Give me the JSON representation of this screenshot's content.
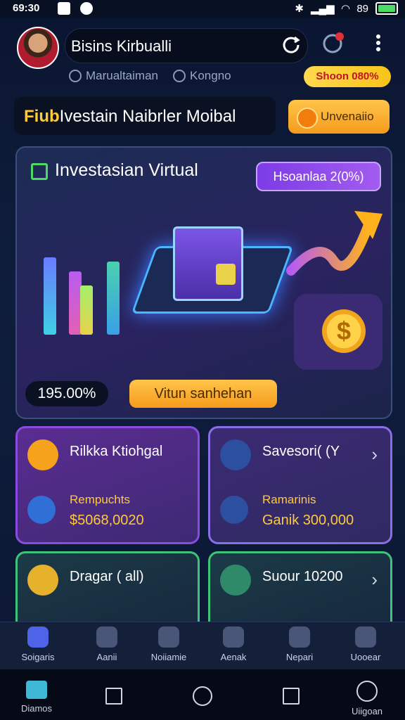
{
  "status": {
    "time": "69:30",
    "battery": "89"
  },
  "header": {
    "search_text": "Bisins Kirbualli"
  },
  "locations": [
    "Marualtaiman",
    "Kongno"
  ],
  "promo_pill": "Shoon 080%",
  "title_bar": {
    "prefix": "Fiub",
    "rest": "Ivestain Naibrler  Moibal"
  },
  "invest_button": "Unvenaiio",
  "hero": {
    "title": "Investasian Virtual",
    "percent_badge": "Hsoanlaa 2(0%)",
    "rate": "195.00%",
    "cta": "Vitun sanhehan"
  },
  "cards": [
    {
      "title": "Rilkka Ktiohgal",
      "label": "Rempuchts",
      "value": "$5068,0020"
    },
    {
      "title": "Savesori( (Y",
      "label": "Ramarinis",
      "value": "Ganik 300,000"
    },
    {
      "title": "Dragar ( all)",
      "label": "",
      "value": ""
    },
    {
      "title": "Suour 10200",
      "label": "",
      "value": ""
    }
  ],
  "nav": [
    "Soigaris",
    "Aanii",
    "Noiiamie",
    "Aenak",
    "Nepari",
    "Uooear"
  ],
  "system_nav": {
    "left": "Diamos",
    "right": "Uiigoan"
  }
}
